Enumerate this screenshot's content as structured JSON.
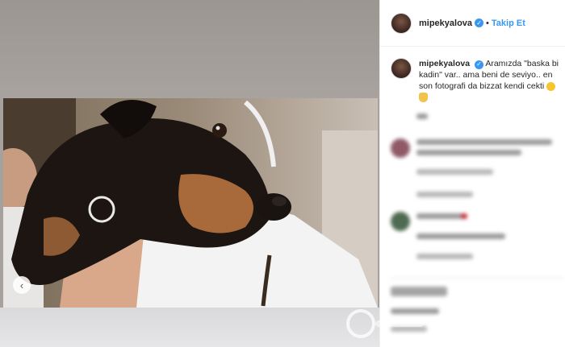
{
  "post": {
    "author": "mipekyalova",
    "follow_label": "Takip Et",
    "separator": "•",
    "caption_text": "Aramızda \"baska bi kadin\" var.. ama beni de seviyo.. en son fotografi da bizzat kendi cekti",
    "prev_arrow": "‹"
  },
  "icons": {
    "verified": "verified-badge-icon",
    "emoji_face": "smiling-face-icon",
    "emoji_hands": "praying-hands-icon"
  },
  "colors": {
    "link_blue": "#3897f0",
    "text": "#262626",
    "verified_blue": "#3897f0"
  }
}
